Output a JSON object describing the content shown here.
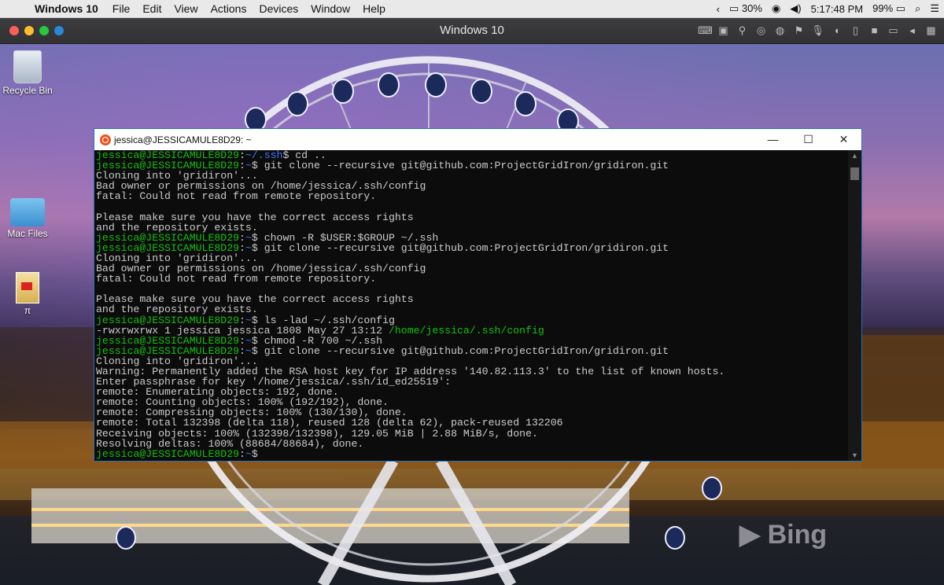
{
  "menubar": {
    "app_name": "Windows 10",
    "menus": [
      "File",
      "Edit",
      "View",
      "Actions",
      "Devices",
      "Window",
      "Help"
    ],
    "battery_vm": "30%",
    "time": "5:17:48 PM",
    "battery": "99%"
  },
  "parallels": {
    "title": "Windows 10"
  },
  "desktop": {
    "icons": [
      {
        "label": "Recycle Bin"
      },
      {
        "label": "Mac Files"
      },
      {
        "label": "π"
      }
    ],
    "watermark": "Bing"
  },
  "terminal": {
    "title": "jessica@JESSICAMULE8D29: ~",
    "prompt_user": "jessica@JESSICAMULE8D29",
    "lines": [
      {
        "segments": [
          {
            "t": "jessica@JESSICAMULE8D29",
            "c": "g"
          },
          {
            "t": ":",
            "c": "w"
          },
          {
            "t": "~/.ssh",
            "c": "b"
          },
          {
            "t": "$ cd ..",
            "c": "w"
          }
        ]
      },
      {
        "segments": [
          {
            "t": "jessica@JESSICAMULE8D29",
            "c": "g"
          },
          {
            "t": ":",
            "c": "w"
          },
          {
            "t": "~",
            "c": "b"
          },
          {
            "t": "$ git clone --recursive git@github.com:ProjectGridIron/gridiron.git",
            "c": "w"
          }
        ]
      },
      {
        "segments": [
          {
            "t": "Cloning into 'gridiron'...",
            "c": "w"
          }
        ]
      },
      {
        "segments": [
          {
            "t": "Bad owner or permissions on /home/jessica/.ssh/config",
            "c": "w"
          }
        ]
      },
      {
        "segments": [
          {
            "t": "fatal: Could not read from remote repository.",
            "c": "w"
          }
        ]
      },
      {
        "segments": [
          {
            "t": "",
            "c": "w"
          }
        ]
      },
      {
        "segments": [
          {
            "t": "Please make sure you have the correct access rights",
            "c": "w"
          }
        ]
      },
      {
        "segments": [
          {
            "t": "and the repository exists.",
            "c": "w"
          }
        ]
      },
      {
        "segments": [
          {
            "t": "jessica@JESSICAMULE8D29",
            "c": "g"
          },
          {
            "t": ":",
            "c": "w"
          },
          {
            "t": "~",
            "c": "b"
          },
          {
            "t": "$ chown -R $USER:$GROUP ~/.ssh",
            "c": "w"
          }
        ]
      },
      {
        "segments": [
          {
            "t": "jessica@JESSICAMULE8D29",
            "c": "g"
          },
          {
            "t": ":",
            "c": "w"
          },
          {
            "t": "~",
            "c": "b"
          },
          {
            "t": "$ git clone --recursive git@github.com:ProjectGridIron/gridiron.git",
            "c": "w"
          }
        ]
      },
      {
        "segments": [
          {
            "t": "Cloning into 'gridiron'...",
            "c": "w"
          }
        ]
      },
      {
        "segments": [
          {
            "t": "Bad owner or permissions on /home/jessica/.ssh/config",
            "c": "w"
          }
        ]
      },
      {
        "segments": [
          {
            "t": "fatal: Could not read from remote repository.",
            "c": "w"
          }
        ]
      },
      {
        "segments": [
          {
            "t": "",
            "c": "w"
          }
        ]
      },
      {
        "segments": [
          {
            "t": "Please make sure you have the correct access rights",
            "c": "w"
          }
        ]
      },
      {
        "segments": [
          {
            "t": "and the repository exists.",
            "c": "w"
          }
        ]
      },
      {
        "segments": [
          {
            "t": "jessica@JESSICAMULE8D29",
            "c": "g"
          },
          {
            "t": ":",
            "c": "w"
          },
          {
            "t": "~",
            "c": "b"
          },
          {
            "t": "$ ls -lad ~/.ssh/config",
            "c": "w"
          }
        ]
      },
      {
        "segments": [
          {
            "t": "-rwxrwxrwx 1 jessica jessica 1808 May 27 13:12 ",
            "c": "w"
          },
          {
            "t": "/home/jessica/.ssh/config",
            "c": "g"
          }
        ]
      },
      {
        "segments": [
          {
            "t": "jessica@JESSICAMULE8D29",
            "c": "g"
          },
          {
            "t": ":",
            "c": "w"
          },
          {
            "t": "~",
            "c": "b"
          },
          {
            "t": "$ chmod -R 700 ~/.ssh",
            "c": "w"
          }
        ]
      },
      {
        "segments": [
          {
            "t": "jessica@JESSICAMULE8D29",
            "c": "g"
          },
          {
            "t": ":",
            "c": "w"
          },
          {
            "t": "~",
            "c": "b"
          },
          {
            "t": "$ git clone --recursive git@github.com:ProjectGridIron/gridiron.git",
            "c": "w"
          }
        ]
      },
      {
        "segments": [
          {
            "t": "Cloning into 'gridiron'...",
            "c": "w"
          }
        ]
      },
      {
        "segments": [
          {
            "t": "Warning: Permanently added the RSA host key for IP address '140.82.113.3' to the list of known hosts.",
            "c": "w"
          }
        ]
      },
      {
        "segments": [
          {
            "t": "Enter passphrase for key '/home/jessica/.ssh/id_ed25519':",
            "c": "w"
          }
        ]
      },
      {
        "segments": [
          {
            "t": "remote: Enumerating objects: 192, done.",
            "c": "w"
          }
        ]
      },
      {
        "segments": [
          {
            "t": "remote: Counting objects: 100% (192/192), done.",
            "c": "w"
          }
        ]
      },
      {
        "segments": [
          {
            "t": "remote: Compressing objects: 100% (130/130), done.",
            "c": "w"
          }
        ]
      },
      {
        "segments": [
          {
            "t": "remote: Total 132398 (delta 118), reused 128 (delta 62), pack-reused 132206",
            "c": "w"
          }
        ]
      },
      {
        "segments": [
          {
            "t": "Receiving objects: 100% (132398/132398), 129.05 MiB | 2.88 MiB/s, done.",
            "c": "w"
          }
        ]
      },
      {
        "segments": [
          {
            "t": "Resolving deltas: 100% (88684/88684), done.",
            "c": "w"
          }
        ]
      },
      {
        "segments": [
          {
            "t": "jessica@JESSICAMULE8D29",
            "c": "g"
          },
          {
            "t": ":",
            "c": "w"
          },
          {
            "t": "~",
            "c": "b"
          },
          {
            "t": "$",
            "c": "w"
          }
        ]
      }
    ]
  },
  "colors": {
    "prompt_green": "#13c10e",
    "path_blue": "#3b78ff",
    "text_gray": "#cccccc",
    "terminal_bg": "#0c0c0c",
    "window_border": "#2b6fc0"
  }
}
